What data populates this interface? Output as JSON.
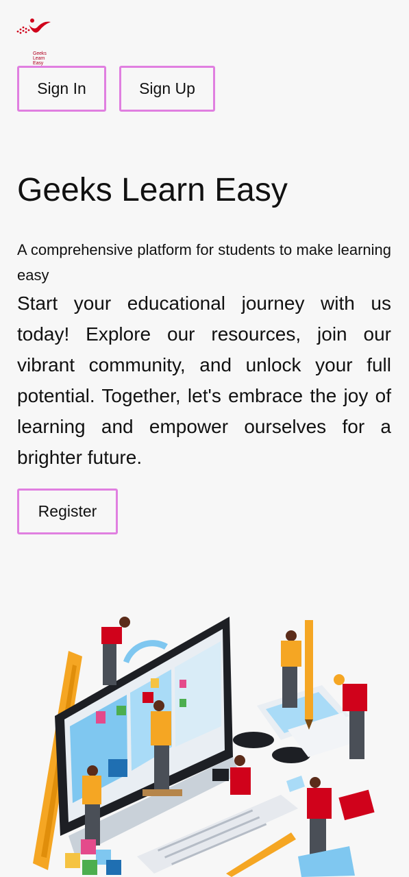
{
  "header": {
    "logo_text": "Geeks Learn Easy"
  },
  "auth": {
    "sign_in_label": "Sign In",
    "sign_up_label": "Sign Up"
  },
  "hero": {
    "title": "Geeks Learn Easy",
    "subtitle": "A comprehensive platform for students to make learning easy",
    "body": "Start your educational journey with us today! Explore our resources, join our vibrant community, and unlock your full potential. Together, let's embrace the joy of learning and empower ourselves for a brighter future.",
    "register_label": "Register"
  },
  "illustration": {
    "icon": "team-building-website-illustration"
  },
  "colors": {
    "background": "#f7f7f7",
    "button_border": "#e07fe0",
    "text": "#111111",
    "logo_accent": "#d0021b"
  }
}
